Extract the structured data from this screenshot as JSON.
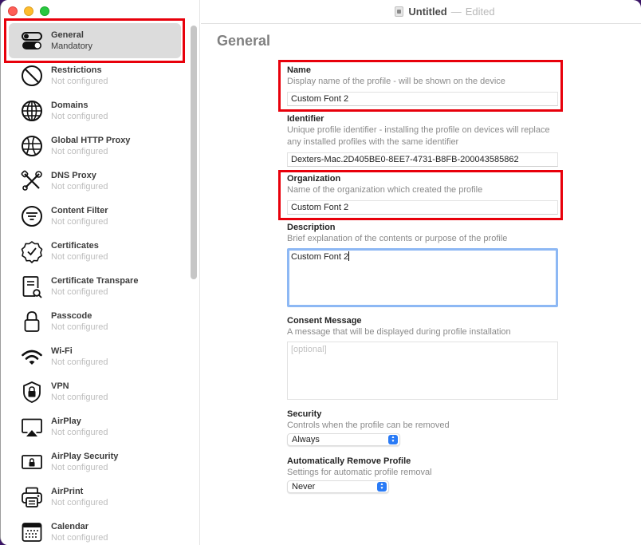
{
  "window": {
    "title": "Untitled",
    "title_separator": "—",
    "title_status": "Edited"
  },
  "sidebar": {
    "items": [
      {
        "title": "General",
        "subtitle": "Mandatory",
        "icon": "toggles-icon",
        "selected": true
      },
      {
        "title": "Restrictions",
        "subtitle": "Not configured",
        "icon": "no-entry-icon"
      },
      {
        "title": "Domains",
        "subtitle": "Not configured",
        "icon": "globe-icon"
      },
      {
        "title": "Global HTTP Proxy",
        "subtitle": "Not configured",
        "icon": "globe-proxy-icon"
      },
      {
        "title": "DNS Proxy",
        "subtitle": "Not configured",
        "icon": "tools-icon"
      },
      {
        "title": "Content Filter",
        "subtitle": "Not configured",
        "icon": "filter-icon"
      },
      {
        "title": "Certificates",
        "subtitle": "Not configured",
        "icon": "certificate-seal-icon"
      },
      {
        "title": "Certificate Transpare",
        "subtitle": "Not configured",
        "icon": "document-search-icon"
      },
      {
        "title": "Passcode",
        "subtitle": "Not configured",
        "icon": "lock-icon"
      },
      {
        "title": "Wi-Fi",
        "subtitle": "Not configured",
        "icon": "wifi-icon"
      },
      {
        "title": "VPN",
        "subtitle": "Not configured",
        "icon": "shield-lock-icon"
      },
      {
        "title": "AirPlay",
        "subtitle": "Not configured",
        "icon": "airplay-icon"
      },
      {
        "title": "AirPlay Security",
        "subtitle": "Not configured",
        "icon": "airplay-lock-icon"
      },
      {
        "title": "AirPrint",
        "subtitle": "Not configured",
        "icon": "printer-icon"
      },
      {
        "title": "Calendar",
        "subtitle": "Not configured",
        "icon": "calendar-icon"
      }
    ]
  },
  "main": {
    "page_title": "General",
    "fields": {
      "name": {
        "label": "Name",
        "description": "Display name of the profile - will be shown on the device",
        "value": "Custom Font 2"
      },
      "identifier": {
        "label": "Identifier",
        "description": "Unique profile identifier - installing the profile on devices will replace any installed profiles with the same identifier",
        "value": "Dexters-Mac.2D405BE0-8EE7-4731-B8FB-200043585862"
      },
      "organization": {
        "label": "Organization",
        "description": "Name of the organization which created the profile",
        "value": "Custom Font 2"
      },
      "description": {
        "label": "Description",
        "description": "Brief explanation of the contents or purpose of the profile",
        "value": "Custom Font 2"
      },
      "consent": {
        "label": "Consent Message",
        "description": "A message that will be displayed during profile installation",
        "placeholder": "[optional]"
      },
      "security": {
        "label": "Security",
        "description": "Controls when the profile can be removed",
        "selected": "Always"
      },
      "auto_remove": {
        "label": "Automatically Remove Profile",
        "description": "Settings for automatic profile removal",
        "selected": "Never"
      }
    }
  },
  "colors": {
    "highlight": "#e8000b",
    "focus_ring": "#8db8f4",
    "select_accent": "#2a7bf6"
  }
}
